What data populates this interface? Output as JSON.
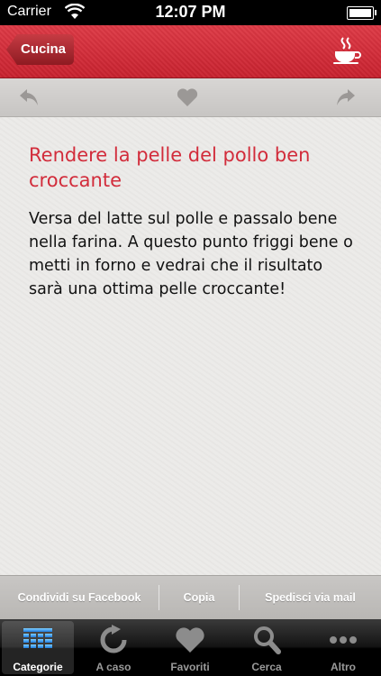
{
  "status_bar": {
    "carrier": "Carrier",
    "time": "12:07 PM",
    "battery_level": 1.0
  },
  "nav_bar": {
    "back_label": "Cucina",
    "right_icon": "coffee-cup-icon",
    "accent": "#d1303d"
  },
  "toolbar": {
    "left_icon": "undo-arrow-icon",
    "center_icon": "heart-icon",
    "right_icon": "redo-arrow-icon"
  },
  "tip": {
    "title": "Rendere la pelle del pollo ben croccante",
    "body": "Versa del latte sul polle e passalo bene nella farina. A questo punto friggi bene o metti in forno e vedrai che il risultato sarà una ottima pelle croccante!"
  },
  "share_bar": {
    "facebook": "Condividi su Facebook",
    "copy": "Copia",
    "mail": "Spedisci via mail"
  },
  "tab_bar": {
    "tabs": [
      {
        "label": "Categorie",
        "icon": "grid-icon",
        "selected": true
      },
      {
        "label": "A caso",
        "icon": "refresh-icon",
        "selected": false
      },
      {
        "label": "Favoriti",
        "icon": "heart-icon",
        "selected": false
      },
      {
        "label": "Cerca",
        "icon": "search-icon",
        "selected": false
      },
      {
        "label": "Altro",
        "icon": "more-icon",
        "selected": false
      }
    ]
  },
  "colors": {
    "title_red": "#d22c3b",
    "nav_red": "#d1303d"
  }
}
